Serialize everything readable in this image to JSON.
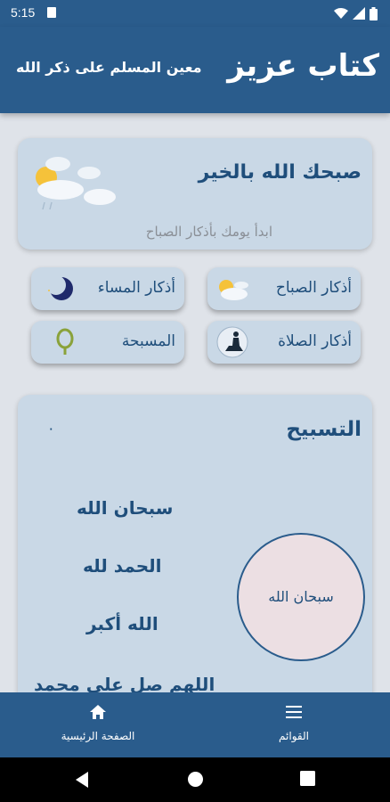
{
  "status_bar": {
    "time": "5:15"
  },
  "app_bar": {
    "title": "كتاب عزيز",
    "subtitle": "معين المسلم على ذكر الله"
  },
  "greeting": {
    "title": "صبحك الله بالخير",
    "subtitle": "ابدأ يومك بأذكار الصباح",
    "icon": "weather-clouds-icon"
  },
  "buttons": {
    "morning": {
      "label": "أذكار الصباح",
      "icon": "sun-cloud-icon"
    },
    "evening": {
      "label": "أذكار المساء",
      "icon": "moon-icon"
    },
    "prayer": {
      "label": "أذكار الصلاة",
      "icon": "praying-person-icon"
    },
    "rosary": {
      "label": "المسبحة",
      "icon": "prayer-beads-icon"
    }
  },
  "tasbih": {
    "title": "التسبيح",
    "count": "٠",
    "items": [
      "سبحان الله",
      "الحمد لله",
      "الله أكبر",
      "اللهم صلِ على محمد"
    ],
    "counter_label": "سبحان الله"
  },
  "bottom_nav": {
    "home": {
      "label": "الصفحة الرئيسية",
      "icon": "home-icon"
    },
    "lists": {
      "label": "القوائم",
      "icon": "menu-icon"
    }
  },
  "colors": {
    "primary": "#2a5c8c",
    "card": "#c9d8e6",
    "text": "#1f4e7b",
    "counter": "#ecdfe3"
  }
}
